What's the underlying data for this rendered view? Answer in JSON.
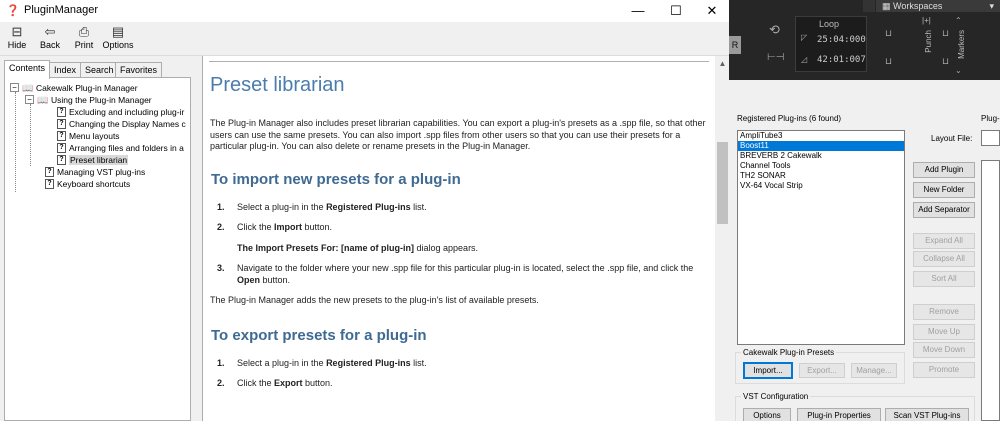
{
  "window": {
    "title": "PluginManager",
    "minimize": "—",
    "maximize": "☐",
    "close": "✕"
  },
  "toolbar": {
    "hide": "Hide",
    "back": "Back",
    "print": "Print",
    "options": "Options"
  },
  "nav": {
    "tabs": [
      "Contents",
      "Index",
      "Search",
      "Favorites"
    ],
    "tree": [
      {
        "label": "Cakewalk Plug-in Manager",
        "type": "book",
        "level": 0
      },
      {
        "label": "Using the Plug-in Manager",
        "type": "book",
        "level": 1
      },
      {
        "label": "Excluding and including plug-ir",
        "type": "page",
        "level": 2
      },
      {
        "label": "Changing the Display Names c",
        "type": "page",
        "level": 2
      },
      {
        "label": "Menu layouts",
        "type": "page",
        "level": 2
      },
      {
        "label": "Arranging files and folders in a",
        "type": "page",
        "level": 2
      },
      {
        "label": "Preset librarian",
        "type": "page",
        "level": 2,
        "selected": true
      },
      {
        "label": "Managing VST plug-ins",
        "type": "page",
        "level": 1
      },
      {
        "label": "Keyboard shortcuts",
        "type": "page",
        "level": 1
      }
    ]
  },
  "article": {
    "title": "Preset librarian",
    "intro": "The Plug-in Manager also includes preset librarian capabilities. You can export a plug-in's presets as a .spp file, so that other users can use the same presets. You can also import .spp files from other users so that you can use their presets for a particular plug-in. You can also delete or rename presets in the Plug-in Manager.",
    "import_heading": "To import new presets for a plug-in",
    "import_steps": {
      "s1_num": "1.",
      "s1_pre": "Select a plug-in in the ",
      "s1_bold": "Registered Plug-ins",
      "s1_post": " list.",
      "s2_num": "2.",
      "s2_pre": "Click the ",
      "s2_bold": "Import",
      "s2_post": " button.",
      "s2_sub_bold": "The Import Presets For: [name of plug-in]",
      "s2_sub_post": " dialog appears.",
      "s3_num": "3.",
      "s3_pre": "Navigate to the folder where your new .spp file for this particular plug-in is located, select the .spp file, and click the ",
      "s3_bold": "Open",
      "s3_post": " button."
    },
    "after_import": "The Plug-in Manager adds the new presets to the plug-in's list of available presets.",
    "export_heading": "To export presets for a plug-in",
    "export_steps": {
      "s1_num": "1.",
      "s1_pre": "Select a plug-in in the ",
      "s1_bold": "Registered Plug-ins",
      "s1_post": " list.",
      "s2_num": "2.",
      "s2_pre": "Click the ",
      "s2_bold": "Export",
      "s2_post": " button."
    }
  },
  "daw": {
    "workspaces": "Workspaces",
    "rec_letter": "R",
    "loop": "Loop",
    "loop_start": "25:04:000",
    "loop_end": "42:01:007",
    "punch": "Punch",
    "markers": "Markers"
  },
  "plugin_manager": {
    "registered_label": "Registered Plug-ins (6 found)",
    "plugins": [
      "AmpliTube3",
      "Boost11",
      "BREVERB 2 Cakewalk",
      "Channel Tools",
      "TH2 SONAR",
      "VX-64 Vocal Strip"
    ],
    "selected_index": 1,
    "plug_label": "Plug-",
    "layout_file_label": "Layout File:",
    "buttons": {
      "add_plugin": "Add Plugin",
      "new_folder": "New Folder",
      "add_separator": "Add Separator",
      "expand_all": "Expand All",
      "collapse_all": "Collapse All",
      "sort_all": "Sort All",
      "remove": "Remove",
      "move_up": "Move Up",
      "move_down": "Move Down",
      "promote": "Promote"
    },
    "presets_group": "Cakewalk Plug-in Presets",
    "import": "Import...",
    "export": "Export...",
    "manage": "Manage...",
    "vst_group": "VST Configuration",
    "options": "Options",
    "plugin_properties": "Plug-in Properties",
    "scan_vst": "Scan VST Plug-ins"
  }
}
